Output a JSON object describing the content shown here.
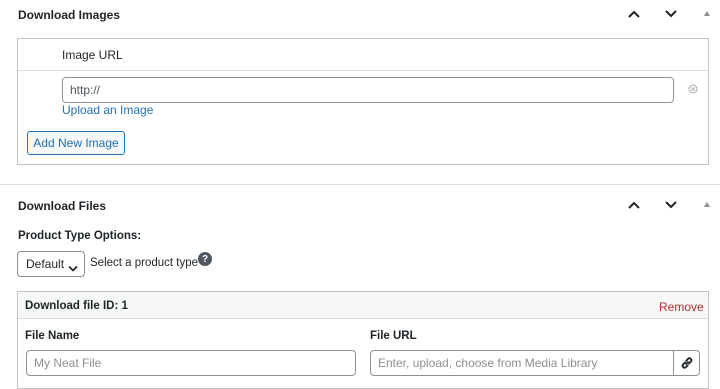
{
  "images_panel": {
    "title": "Download Images",
    "table_header": "Image URL",
    "url_value": "http://",
    "upload_link": "Upload an Image",
    "add_button": "Add New Image"
  },
  "files_panel": {
    "title": "Download Files",
    "product_type_label": "Product Type Options:",
    "select_value": "Default",
    "select_hint": "Select a product type",
    "file_row": {
      "header": "Download file ID: 1",
      "remove": "Remove",
      "file_name_label": "File Name",
      "file_name_placeholder": "My Neat File",
      "file_url_label": "File URL",
      "file_url_placeholder": "Enter, upload, choose from Media Library"
    }
  },
  "colors": {
    "link": "#2271b1",
    "remove": "#b32d2e",
    "border": "#c3c4c7"
  },
  "icons": [
    "chevron-up-icon",
    "chevron-down-icon",
    "collapse-triangle-icon",
    "clear-circle-icon",
    "chevron-down-icon",
    "help-icon",
    "link-icon"
  ]
}
